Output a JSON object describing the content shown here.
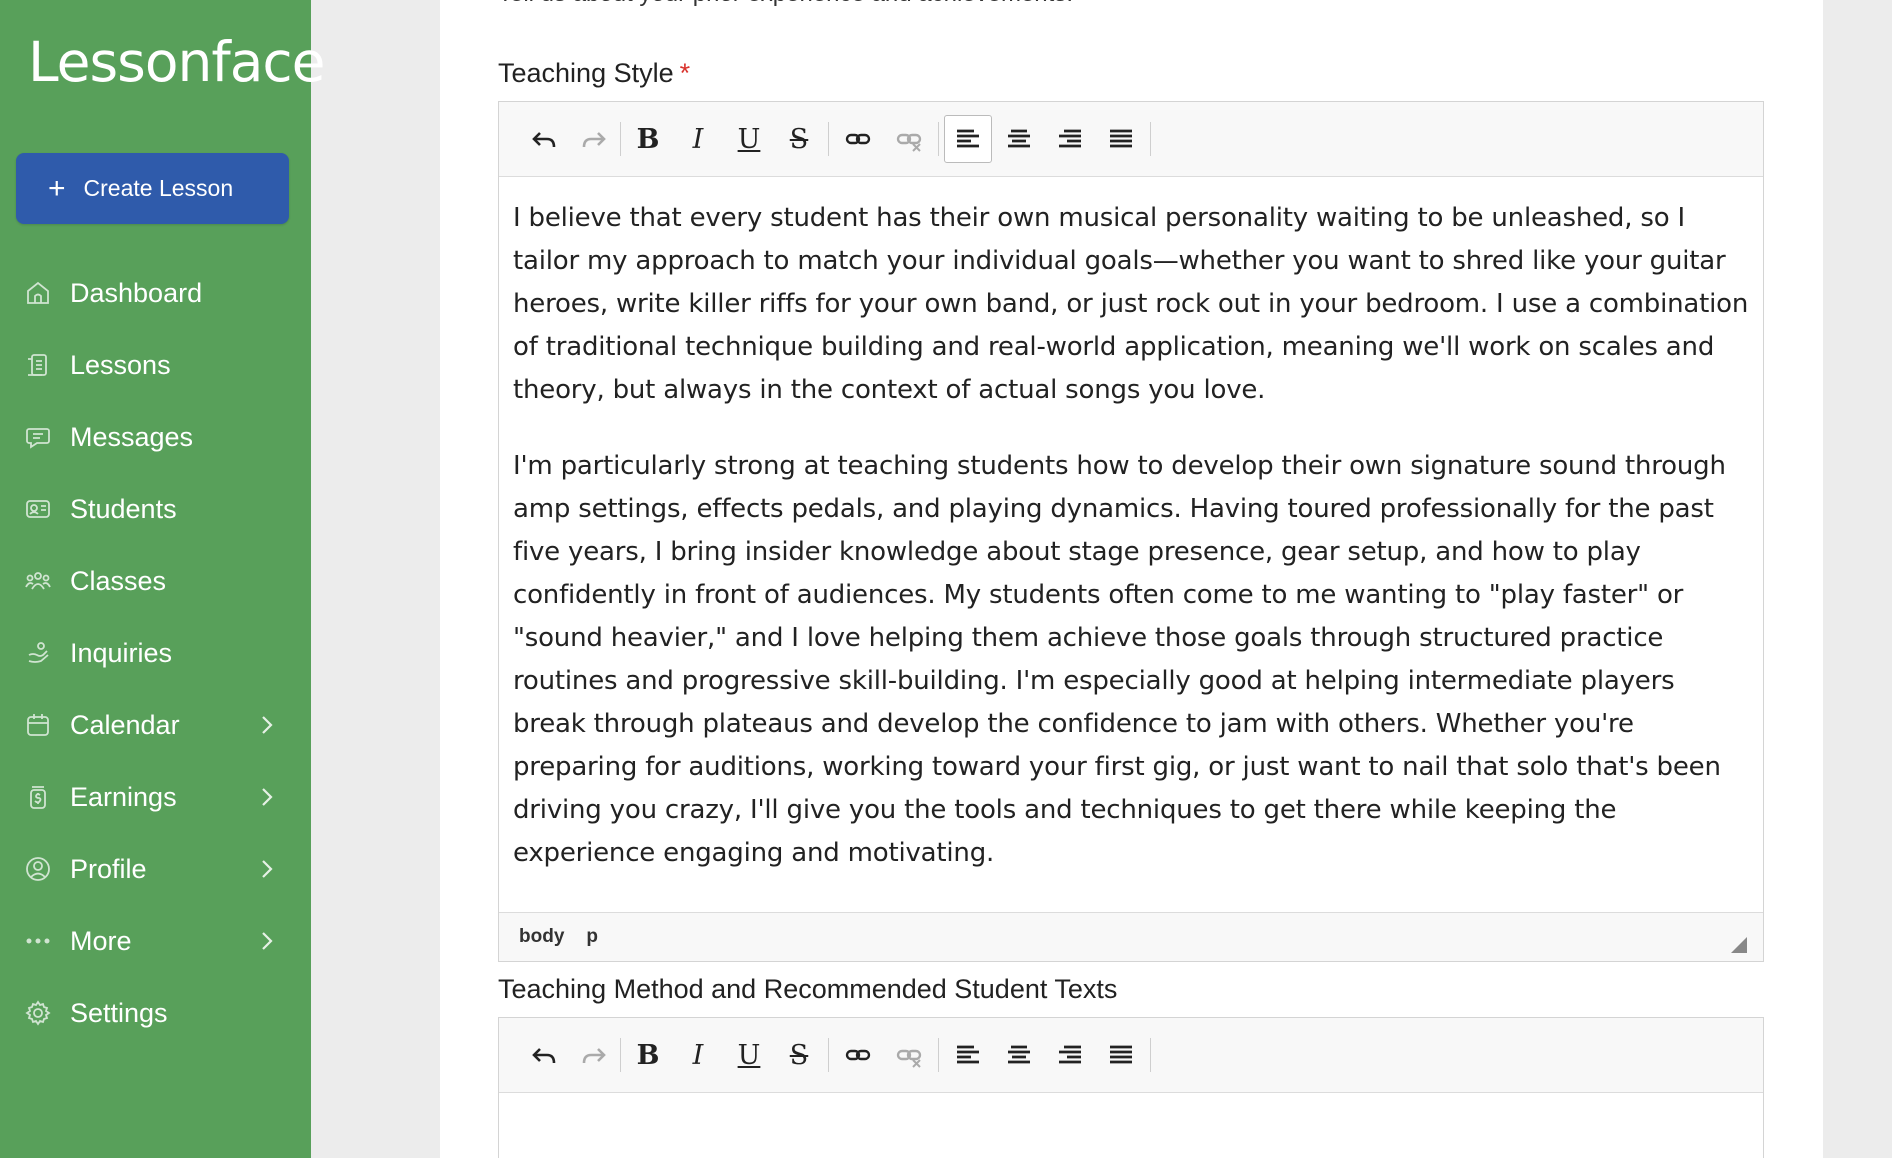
{
  "sidebar": {
    "logo": "Lessonface",
    "create_label": "Create Lesson",
    "items": [
      {
        "label": "Dashboard",
        "icon": "home-icon",
        "submenu": false
      },
      {
        "label": "Lessons",
        "icon": "scroll-icon",
        "submenu": false
      },
      {
        "label": "Messages",
        "icon": "chat-icon",
        "submenu": false
      },
      {
        "label": "Students",
        "icon": "id-card-icon",
        "submenu": false
      },
      {
        "label": "Classes",
        "icon": "group-icon",
        "submenu": false
      },
      {
        "label": "Inquiries",
        "icon": "hand-icon",
        "submenu": false
      },
      {
        "label": "Calendar",
        "icon": "calendar-icon",
        "submenu": true
      },
      {
        "label": "Earnings",
        "icon": "money-jar-icon",
        "submenu": true
      },
      {
        "label": "Profile",
        "icon": "user-circle-icon",
        "submenu": true
      },
      {
        "label": "More",
        "icon": "more-dots-icon",
        "submenu": true
      },
      {
        "label": "Settings",
        "icon": "gear-icon",
        "submenu": false
      }
    ]
  },
  "main": {
    "cut_text": "Tell us about your prior experience and achievements.",
    "teaching_style": {
      "label": "Teaching Style",
      "required_mark": "*",
      "paragraphs": [
        "I believe that every student has their own musical personality waiting to be unleashed, so I tailor my approach to match your individual goals—whether you want to shred like your guitar heroes, write killer riffs for your own band, or just rock out in your bedroom. I use a combination of traditional technique building and real-world application, meaning we'll work on scales and theory, but always in the context of actual songs you love.",
        "I'm particularly strong at teaching students how to develop their own signature sound through amp settings, effects pedals, and playing dynamics. Having toured professionally for the past five years, I bring insider knowledge about stage presence, gear setup, and how to play confidently in front of audiences. My students often come to me wanting to \"play faster\" or \"sound heavier,\" and I love helping them achieve those goals through structured practice routines and progressive skill-building. I'm especially good at helping intermediate players break through plateaus and develop the confidence to jam with others. Whether you're preparing for auditions, working toward your first gig, or just want to nail that solo that's been driving you crazy, I'll give you the tools and techniques to get there while keeping the experience engaging and motivating."
      ],
      "status_path": [
        "body",
        "p"
      ]
    },
    "teaching_method": {
      "label": "Teaching Method and Recommended Student Texts"
    },
    "toolbar": {
      "bold": "B",
      "italic": "I",
      "underline": "U",
      "strike": "S"
    }
  },
  "colors": {
    "sidebar": "#58a05a",
    "create_button": "#2f5bab",
    "required": "#d9322c"
  }
}
